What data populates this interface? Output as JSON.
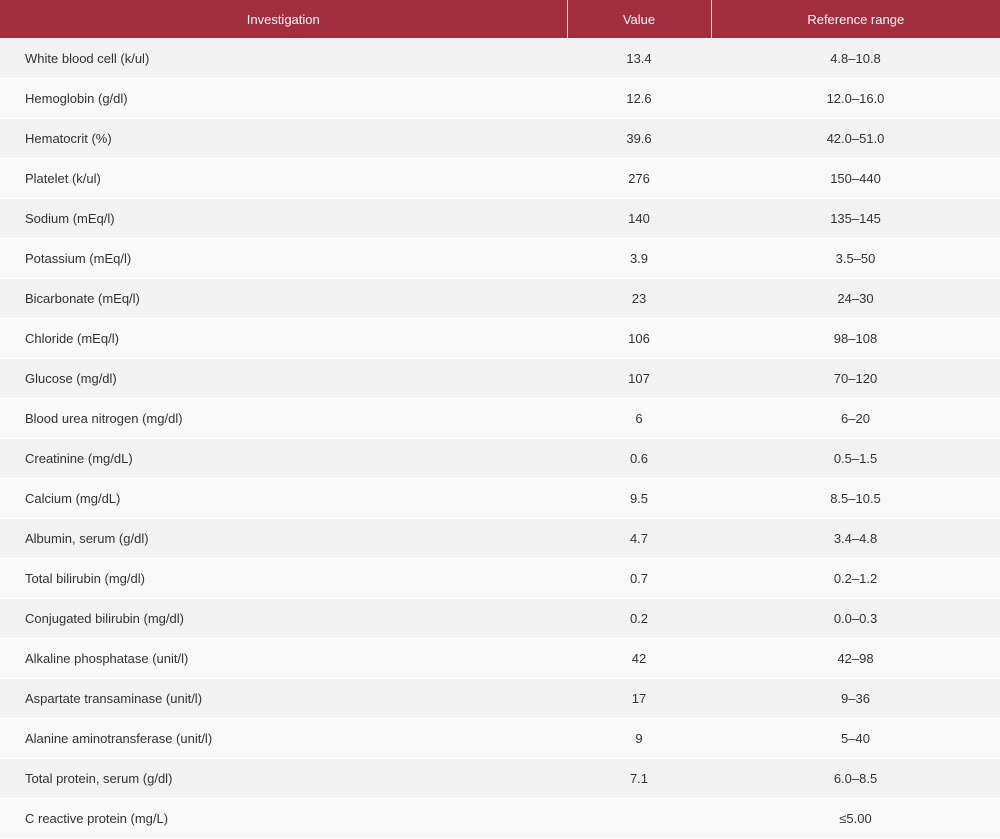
{
  "table": {
    "headers": [
      "Investigation",
      "Value",
      "Reference range"
    ],
    "rows": [
      {
        "investigation": "White blood cell (k/ul)",
        "value": "13.4",
        "reference": "4.8–10.8"
      },
      {
        "investigation": "Hemoglobin (g/dl)",
        "value": "12.6",
        "reference": "12.0–16.0"
      },
      {
        "investigation": "Hematocrit (%)",
        "value": "39.6",
        "reference": "42.0–51.0"
      },
      {
        "investigation": "Platelet (k/ul)",
        "value": "276",
        "reference": "150–440"
      },
      {
        "investigation": "Sodium (mEq/l)",
        "value": "140",
        "reference": "135–145"
      },
      {
        "investigation": "Potassium (mEq/l)",
        "value": "3.9",
        "reference": "3.5–50"
      },
      {
        "investigation": "Bicarbonate (mEq/l)",
        "value": "23",
        "reference": "24–30"
      },
      {
        "investigation": "Chloride (mEq/l)",
        "value": "106",
        "reference": "98–108"
      },
      {
        "investigation": "Glucose (mg/dl)",
        "value": "107",
        "reference": "70–120"
      },
      {
        "investigation": "Blood urea nitrogen (mg/dl)",
        "value": "6",
        "reference": "6–20"
      },
      {
        "investigation": "Creatinine (mg/dL)",
        "value": "0.6",
        "reference": "0.5–1.5"
      },
      {
        "investigation": "Calcium (mg/dL)",
        "value": "9.5",
        "reference": "8.5–10.5"
      },
      {
        "investigation": "Albumin, serum (g/dl)",
        "value": "4.7",
        "reference": "3.4–4.8"
      },
      {
        "investigation": "Total bilirubin (mg/dl)",
        "value": "0.7",
        "reference": "0.2–1.2"
      },
      {
        "investigation": "Conjugated bilirubin (mg/dl)",
        "value": "0.2",
        "reference": "0.0–0.3"
      },
      {
        "investigation": "Alkaline phosphatase (unit/l)",
        "value": "42",
        "reference": "42–98"
      },
      {
        "investigation": "Aspartate transaminase (unit/l)",
        "value": "17",
        "reference": "9–36"
      },
      {
        "investigation": "Alanine aminotransferase (unit/l)",
        "value": "9",
        "reference": "5–40"
      },
      {
        "investigation": "Total protein, serum (g/dl)",
        "value": "7.1",
        "reference": "6.0–8.5"
      },
      {
        "investigation": "C reactive protein (mg/L)",
        "value": "",
        "reference": "≤5.00"
      }
    ]
  },
  "colors": {
    "header_background": "#a22d3c",
    "header_text": "#ffffff",
    "row_odd": "#f2f2f2",
    "row_even": "#f8f8f8"
  }
}
